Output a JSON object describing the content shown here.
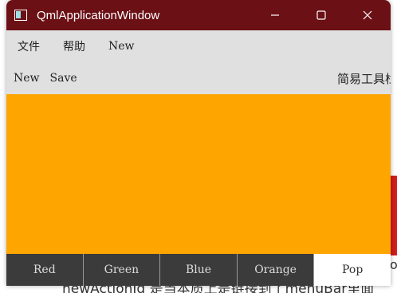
{
  "window": {
    "title": "QmlApplicationWindow"
  },
  "menubar": {
    "items": [
      "文件",
      "帮助",
      "New"
    ]
  },
  "toolbar": {
    "buttons": [
      "New",
      "Save"
    ],
    "title": "简易工具栏"
  },
  "content": {
    "color": "#ffa500"
  },
  "tabbar": {
    "tabs": [
      "Red",
      "Green",
      "Blue",
      "Orange",
      "Pop"
    ],
    "active": "Pop"
  },
  "background": {
    "text": "newActionId 是当本质上是链接到了menuBar里面"
  },
  "colors": {
    "titlebar": "#6b1015",
    "tabbar": "#3b3b3b"
  }
}
